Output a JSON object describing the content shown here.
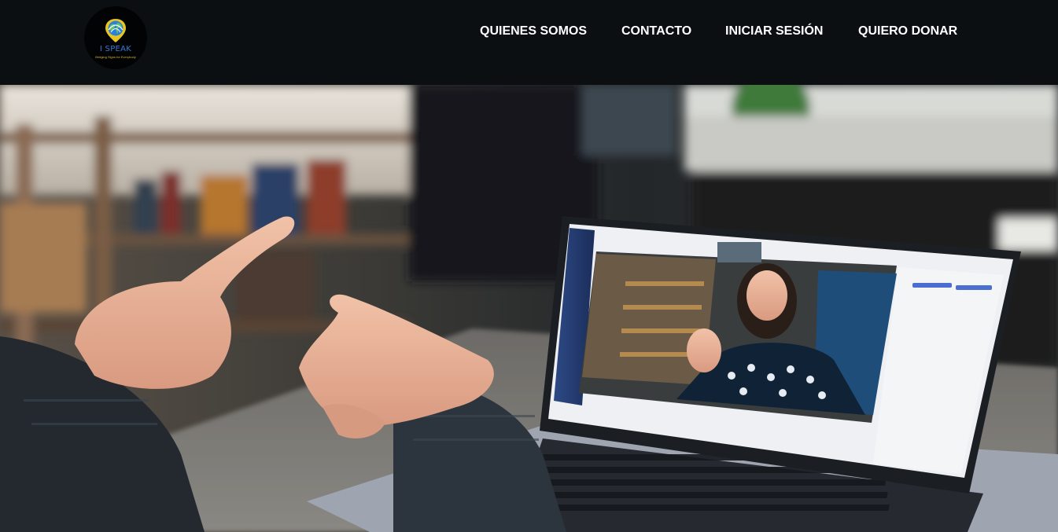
{
  "logo": {
    "text": "I SPEAK",
    "subtitle": "Bridging Signs for Everybody"
  },
  "nav": {
    "items": [
      {
        "label": "QUIENES SOMOS"
      },
      {
        "label": "CONTACTO"
      },
      {
        "label": "INICIAR SESIÓN"
      },
      {
        "label": "QUIERO DONAR"
      }
    ]
  },
  "hero": {
    "image": "photo-person-signing-to-laptop-video-call"
  },
  "colors": {
    "header_bg": "#0b0f11",
    "nav_text": "#ffffff",
    "logo_blue": "#3a7bd5",
    "logo_yellow": "#e8c521"
  }
}
